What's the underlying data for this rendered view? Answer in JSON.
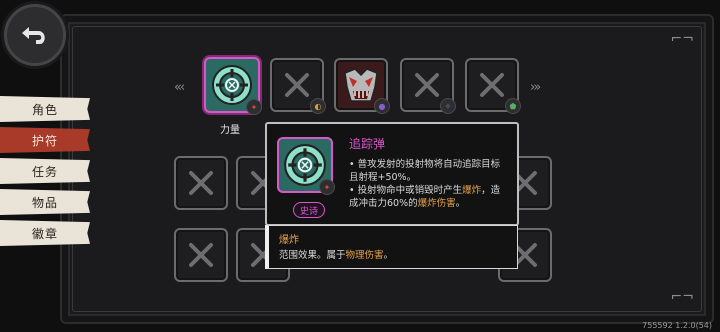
{
  "back_icon": "back-arrow-icon",
  "tabs": [
    "角色",
    "护符",
    "任务",
    "物品",
    "徽章"
  ],
  "active_tab": "护符",
  "top_slots": [
    {
      "label": "力量",
      "state": "selected-crosshair",
      "badge_color": "#d04a4a"
    },
    {
      "label": "",
      "state": "empty",
      "badge_color": "#e0a030"
    },
    {
      "label": "",
      "state": "monster",
      "badge_color": "#8a5ad0"
    },
    {
      "label": "",
      "state": "empty",
      "badge_color": "#4a8ad0"
    },
    {
      "label": "",
      "state": "empty",
      "badge_color": "#5ab060"
    }
  ],
  "tooltip": {
    "title": "追踪弹",
    "line1": "• 普攻发射的投射物将自动追踪目标且射程+50%。",
    "line2_pre": "• 投射物命中或销毁时产生",
    "line2_hl1": "爆炸",
    "line2_mid": "，造成冲击力60%的",
    "line2_hl2": "爆炸伤害",
    "line2_post": "。",
    "rarity": "史诗"
  },
  "tooltip2": {
    "title": "爆炸",
    "desc_pre": "范围效果。属于",
    "desc_hl": "物理伤害",
    "desc_post": "。"
  },
  "version": "755592 1.2.0(54)"
}
